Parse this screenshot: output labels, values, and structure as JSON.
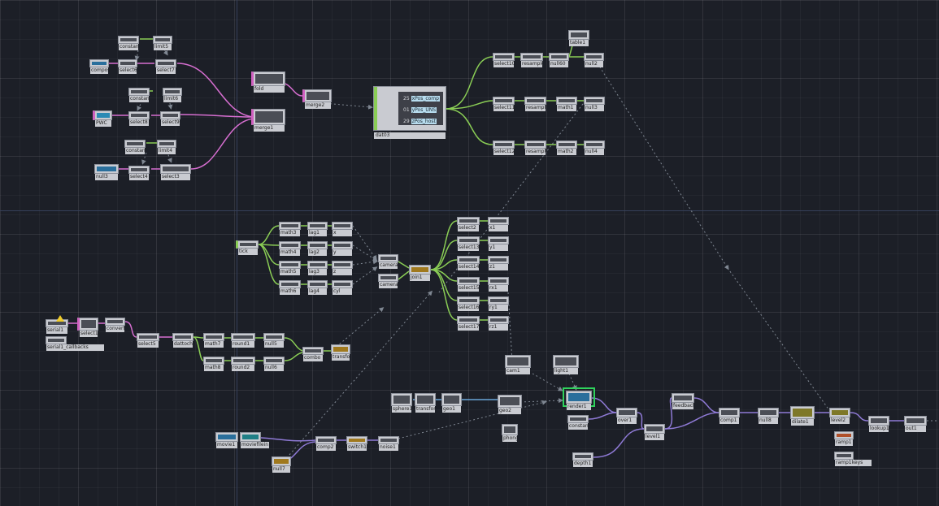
{
  "editor": {
    "table_rows": [
      {
        "num": "25",
        "name": "xPos_comp"
      },
      {
        "num": "01",
        "name": "yPos_UNS"
      },
      {
        "num": "29",
        "name": "zPos_host"
      }
    ]
  },
  "nodes": [
    {
      "id": "constant3",
      "label": "constant3"
    },
    {
      "id": "limit5",
      "label": "limit5"
    },
    {
      "id": "compositeIn",
      "label": "compositeIn"
    },
    {
      "id": "select6",
      "label": "select6"
    },
    {
      "id": "select7",
      "label": "select7"
    },
    {
      "id": "constant4",
      "label": "constant4"
    },
    {
      "id": "limit6",
      "label": "limit6"
    },
    {
      "id": "pwc",
      "label": "PWC"
    },
    {
      "id": "select8",
      "label": "select8"
    },
    {
      "id": "select9",
      "label": "select9"
    },
    {
      "id": "constant2",
      "label": "constant2"
    },
    {
      "id": "limit4",
      "label": "limit4"
    },
    {
      "id": "null3",
      "label": "null3"
    },
    {
      "id": "select4",
      "label": "select4"
    },
    {
      "id": "select3",
      "label": "select3"
    },
    {
      "id": "fold",
      "label": "fold"
    },
    {
      "id": "merge1",
      "label": "merge1"
    },
    {
      "id": "merge2",
      "label": "merge2"
    },
    {
      "id": "dat3",
      "label": "dat03"
    },
    {
      "id": "select10",
      "label": "select10"
    },
    {
      "id": "resample5",
      "label": "resample5"
    },
    {
      "id": "null60",
      "label": "null60"
    },
    {
      "id": "table1",
      "label": "table1"
    },
    {
      "id": "null2",
      "label": "null2"
    },
    {
      "id": "select11",
      "label": "select11"
    },
    {
      "id": "resample6",
      "label": "resample6"
    },
    {
      "id": "math1",
      "label": "math1"
    },
    {
      "id": "null3b",
      "label": "null3"
    },
    {
      "id": "select12",
      "label": "select12"
    },
    {
      "id": "resample7",
      "label": "resample7"
    },
    {
      "id": "math2",
      "label": "math2"
    },
    {
      "id": "null4",
      "label": "null4"
    },
    {
      "id": "tick",
      "label": "tick"
    },
    {
      "id": "math3",
      "label": "math3"
    },
    {
      "id": "lag1",
      "label": "lag1"
    },
    {
      "id": "x",
      "label": "x"
    },
    {
      "id": "math4",
      "label": "math4"
    },
    {
      "id": "lag2",
      "label": "lag2"
    },
    {
      "id": "y",
      "label": "y"
    },
    {
      "id": "math5",
      "label": "math5"
    },
    {
      "id": "lag3",
      "label": "lag3"
    },
    {
      "id": "z",
      "label": "z"
    },
    {
      "id": "math6",
      "label": "math6"
    },
    {
      "id": "lag4",
      "label": "lag4"
    },
    {
      "id": "cyl",
      "label": "cyl"
    },
    {
      "id": "cameraT",
      "label": "cameraT"
    },
    {
      "id": "camerasecond",
      "label": "camerasecond"
    },
    {
      "id": "join1",
      "label": "join1"
    },
    {
      "id": "select2",
      "label": "select2"
    },
    {
      "id": "x1",
      "label": "x1"
    },
    {
      "id": "select13",
      "label": "select13"
    },
    {
      "id": "y1",
      "label": "y1"
    },
    {
      "id": "select14",
      "label": "select14"
    },
    {
      "id": "z1",
      "label": "z1"
    },
    {
      "id": "select15",
      "label": "select15"
    },
    {
      "id": "rx1",
      "label": "rx1"
    },
    {
      "id": "select16",
      "label": "select16"
    },
    {
      "id": "ry1",
      "label": "ry1"
    },
    {
      "id": "select17",
      "label": "select17"
    },
    {
      "id": "rz1",
      "label": "rz1"
    },
    {
      "id": "serial1",
      "label": "serial1"
    },
    {
      "id": "serial1_callbacks",
      "label": "serial1_callbacks"
    },
    {
      "id": "select1",
      "label": "select1"
    },
    {
      "id": "convert",
      "label": "convert"
    },
    {
      "id": "select5",
      "label": "select5"
    },
    {
      "id": "dattochop",
      "label": "dattochop"
    },
    {
      "id": "math7",
      "label": "math7"
    },
    {
      "id": "round1",
      "label": "round1"
    },
    {
      "id": "null5",
      "label": "null5"
    },
    {
      "id": "math8",
      "label": "math8"
    },
    {
      "id": "round2",
      "label": "round2"
    },
    {
      "id": "null6",
      "label": "null6"
    },
    {
      "id": "combo",
      "label": "combo"
    },
    {
      "id": "transform",
      "label": "transform"
    },
    {
      "id": "cam1",
      "label": "cam1"
    },
    {
      "id": "light1",
      "label": "light1"
    },
    {
      "id": "sphere1",
      "label": "sphere1"
    },
    {
      "id": "transform2",
      "label": "transform2"
    },
    {
      "id": "geo1",
      "label": "geo1"
    },
    {
      "id": "geo2",
      "label": "geo2"
    },
    {
      "id": "phong1",
      "label": "phong1"
    },
    {
      "id": "render1",
      "label": "render1"
    },
    {
      "id": "constant1",
      "label": "constant1"
    },
    {
      "id": "over1",
      "label": "over1"
    },
    {
      "id": "feedback1",
      "label": "feedback1"
    },
    {
      "id": "level1",
      "label": "level1"
    },
    {
      "id": "comp1",
      "label": "comp1"
    },
    {
      "id": "null8",
      "label": "null8"
    },
    {
      "id": "dilate1",
      "label": "dilate1"
    },
    {
      "id": "level2",
      "label": "level2"
    },
    {
      "id": "moviein",
      "label": "moviein1"
    },
    {
      "id": "movieout",
      "label": "movieout"
    },
    {
      "id": "ramp1",
      "label": "ramp1"
    },
    {
      "id": "ramp1keys",
      "label": "ramp1keys"
    },
    {
      "id": "lookup1",
      "label": "lookup1"
    },
    {
      "id": "out1",
      "label": "out1"
    },
    {
      "id": "movie1",
      "label": "movie1"
    },
    {
      "id": "moviefilein",
      "label": "moviefilein"
    },
    {
      "id": "comp2",
      "label": "comp2"
    },
    {
      "id": "switch1",
      "label": "switch1"
    },
    {
      "id": "null7",
      "label": "null7"
    },
    {
      "id": "noise1",
      "label": "noise1"
    },
    {
      "id": "depth1",
      "label": "depth1"
    }
  ]
}
